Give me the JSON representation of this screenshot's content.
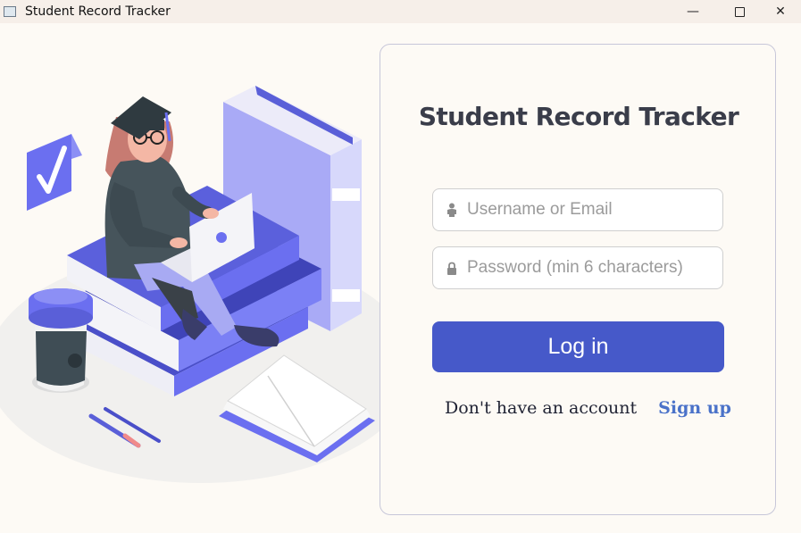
{
  "window": {
    "title": "Student Record Tracker",
    "controls": {
      "minimize": "—",
      "close": "✕"
    }
  },
  "login": {
    "heading": "Student Record Tracker",
    "username_placeholder": "Username or Email",
    "username_value": "",
    "password_placeholder": "Password (min 6 characters)",
    "password_value": "",
    "login_label": "Log in",
    "no_account_text": "Don't have an account",
    "signup_label": "Sign up"
  },
  "icons": {
    "username": "person-icon",
    "password": "lock-icon"
  },
  "colors": {
    "background": "#fdfaf5",
    "primary_button": "#4659c9",
    "link": "#4a72c9",
    "heading": "#3a3d4a",
    "illustration_accent": "#6b6ff0"
  }
}
